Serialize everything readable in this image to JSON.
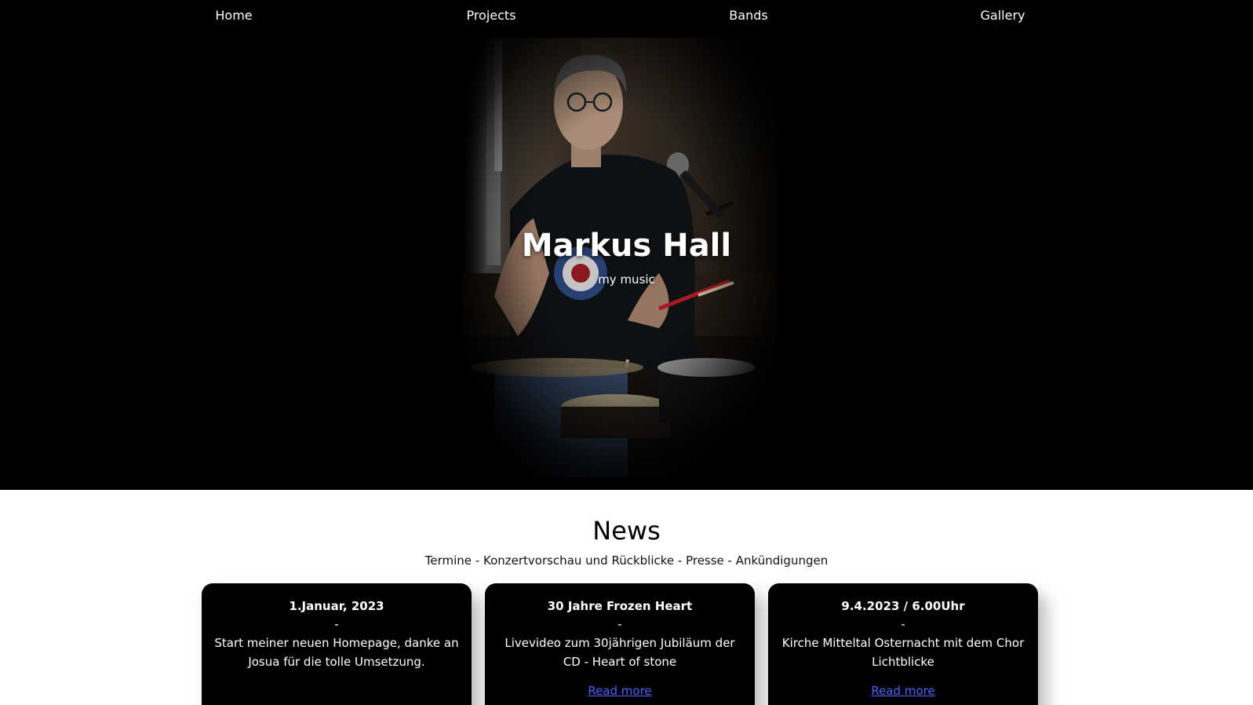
{
  "nav": {
    "items": [
      {
        "label": "Home"
      },
      {
        "label": "Projects"
      },
      {
        "label": "Bands"
      },
      {
        "label": "Gallery"
      }
    ]
  },
  "hero": {
    "title": "Markus Hall",
    "subtitle": "my music"
  },
  "news": {
    "title": "News",
    "subtitle": "Termine - Konzertvorschau und Rückblicke - Presse - Ankündigungen",
    "cards": [
      {
        "date": "1.Januar, 2023",
        "separator": "-",
        "text": "Start meiner neuen Homepage, danke an Josua für die tolle Umsetzung.",
        "link": ""
      },
      {
        "date": "30 Jahre Frozen Heart",
        "separator": "-",
        "text": "Livevideo zum 30jährigen Jubiläum der CD - Heart of stone",
        "link": "Read more"
      },
      {
        "date": "9.4.2023 / 6.00Uhr",
        "separator": "-",
        "text": "Kirche Mitteltal Osternacht mit dem Chor Lichtblicke",
        "link": "Read more"
      }
    ]
  },
  "colors": {
    "hero_bg": "#000000",
    "card_bg": "#000000",
    "link": "#4a63ff"
  }
}
